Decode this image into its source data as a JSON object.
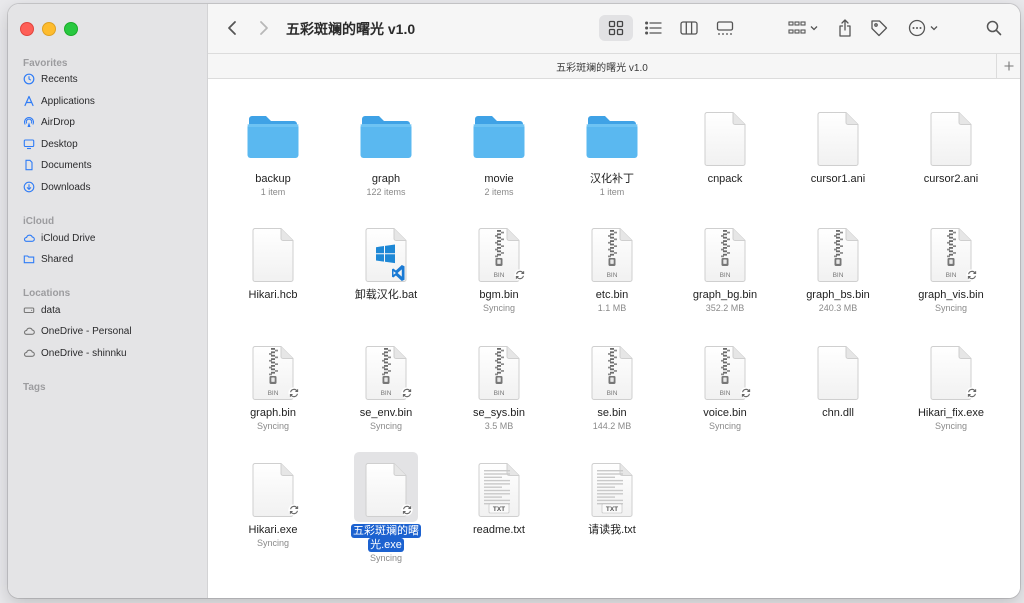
{
  "window_title": "五彩斑斓的曙光 v1.0",
  "path_title": "五彩斑斓的曙光 v1.0",
  "sidebar": {
    "favorites_label": "Favorites",
    "favorites": [
      {
        "label": "Recents",
        "icon": "clock-icon"
      },
      {
        "label": "Applications",
        "icon": "applications-icon"
      },
      {
        "label": "AirDrop",
        "icon": "airdrop-icon"
      },
      {
        "label": "Desktop",
        "icon": "desktop-icon"
      },
      {
        "label": "Documents",
        "icon": "document-icon"
      },
      {
        "label": "Downloads",
        "icon": "download-icon"
      }
    ],
    "icloud_label": "iCloud",
    "icloud": [
      {
        "label": "iCloud Drive",
        "icon": "cloud-icon"
      },
      {
        "label": "Shared",
        "icon": "shared-folder-icon"
      }
    ],
    "locations_label": "Locations",
    "locations": [
      {
        "label": "data",
        "icon": "drive-icon"
      },
      {
        "label": "OneDrive - Personal",
        "icon": "cloud-icon"
      },
      {
        "label": "OneDrive - shinnku",
        "icon": "cloud-icon"
      }
    ],
    "tags_label": "Tags"
  },
  "files": [
    {
      "name": "backup",
      "meta": "1 item",
      "kind": "folder"
    },
    {
      "name": "graph",
      "meta": "122 items",
      "kind": "folder"
    },
    {
      "name": "movie",
      "meta": "2 items",
      "kind": "folder"
    },
    {
      "name": "汉化补丁",
      "meta": "1 item",
      "kind": "folder"
    },
    {
      "name": "cnpack",
      "meta": "",
      "kind": "doc"
    },
    {
      "name": "cursor1.ani",
      "meta": "",
      "kind": "doc"
    },
    {
      "name": "cursor2.ani",
      "meta": "",
      "kind": "doc"
    },
    {
      "name": "Hikari.hcb",
      "meta": "",
      "kind": "doc"
    },
    {
      "name": "卸载汉化.bat",
      "meta": "",
      "kind": "bat"
    },
    {
      "name": "bgm.bin",
      "meta": "Syncing",
      "kind": "bin",
      "sync": true
    },
    {
      "name": "etc.bin",
      "meta": "1.1 MB",
      "kind": "bin"
    },
    {
      "name": "graph_bg.bin",
      "meta": "352.2 MB",
      "kind": "bin"
    },
    {
      "name": "graph_bs.bin",
      "meta": "240.3 MB",
      "kind": "bin"
    },
    {
      "name": "graph_vis.bin",
      "meta": "Syncing",
      "kind": "bin",
      "sync": true
    },
    {
      "name": "graph.bin",
      "meta": "Syncing",
      "kind": "bin",
      "sync": true
    },
    {
      "name": "se_env.bin",
      "meta": "Syncing",
      "kind": "bin",
      "sync": true
    },
    {
      "name": "se_sys.bin",
      "meta": "3.5 MB",
      "kind": "bin"
    },
    {
      "name": "se.bin",
      "meta": "144.2 MB",
      "kind": "bin"
    },
    {
      "name": "voice.bin",
      "meta": "Syncing",
      "kind": "bin",
      "sync": true
    },
    {
      "name": "chn.dll",
      "meta": "",
      "kind": "doc"
    },
    {
      "name": "Hikari_fix.exe",
      "meta": "Syncing",
      "kind": "doc",
      "sync": true
    },
    {
      "name": "Hikari.exe",
      "meta": "Syncing",
      "kind": "doc",
      "sync": true
    },
    {
      "name": "五彩斑斓的曙光.exe",
      "name_line1": "五彩斑斓的曙",
      "name_line2": "光.exe",
      "meta": "Syncing",
      "kind": "doc",
      "sync": true,
      "selected": true
    },
    {
      "name": "readme.txt",
      "meta": "",
      "kind": "txt"
    },
    {
      "name": "请读我.txt",
      "meta": "",
      "kind": "txt"
    }
  ],
  "labels": {
    "bin": "BIN",
    "txt": "TXT"
  },
  "colors": {
    "folder": "#5ab8f0",
    "folder_dark": "#3fa2e6",
    "selection": "#1c62d0"
  }
}
